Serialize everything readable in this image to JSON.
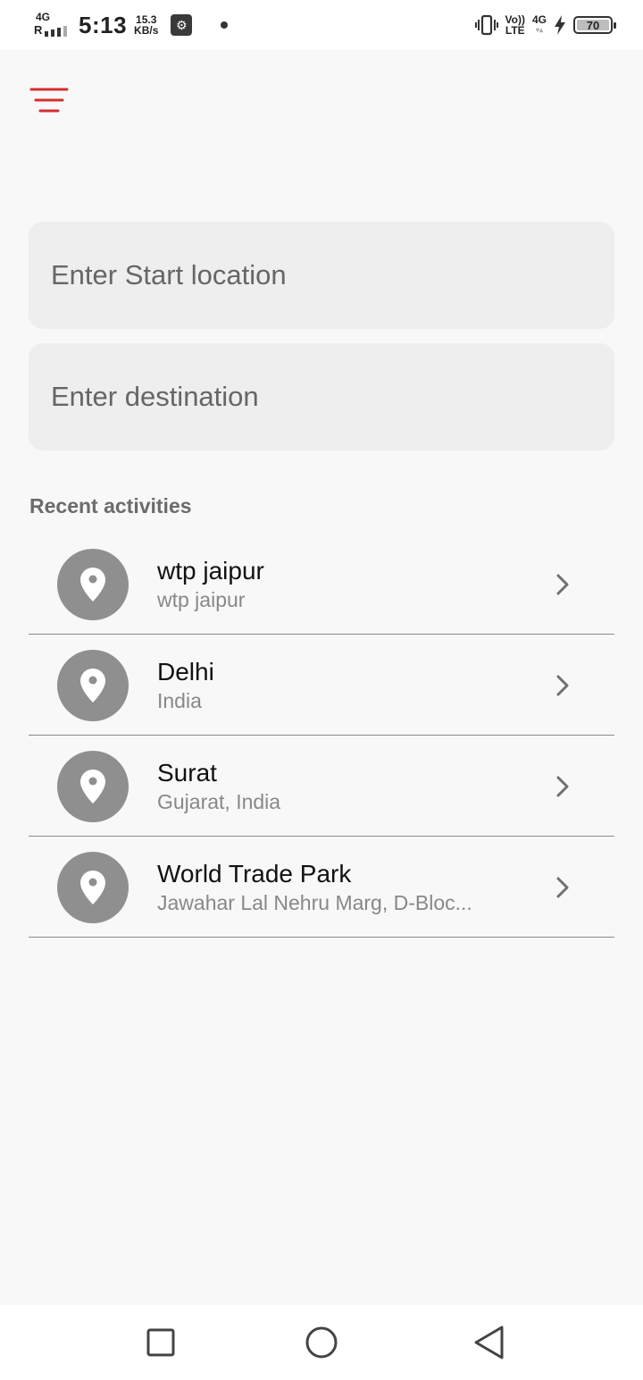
{
  "status_bar": {
    "network_type": "4G",
    "roaming": "R",
    "time": "5:13",
    "speed_value": "15.3",
    "speed_unit": "KB/s",
    "volte_top": "Vo))",
    "volte_bottom": "LTE",
    "data_type": "4G",
    "battery_level": "70",
    "icons": [
      "signal-icon",
      "usb-icon",
      "notification-dot-icon",
      "vibrate-icon",
      "charging-icon",
      "battery-icon"
    ]
  },
  "menu": {
    "icon": "hamburger-menu-icon",
    "color": "#d32f2f"
  },
  "search": {
    "start_placeholder": "Enter Start location",
    "destination_placeholder": "Enter destination"
  },
  "recent": {
    "heading": "Recent activities",
    "items": [
      {
        "title": "wtp jaipur",
        "subtitle": "wtp jaipur"
      },
      {
        "title": "Delhi",
        "subtitle": "India"
      },
      {
        "title": "Surat",
        "subtitle": "Gujarat, India"
      },
      {
        "title": "World Trade Park",
        "subtitle": "Jawahar Lal Nehru Marg, D-Bloc..."
      }
    ]
  },
  "nav_bar": {
    "icons": [
      "recents-square-icon",
      "home-circle-icon",
      "back-triangle-icon"
    ]
  }
}
